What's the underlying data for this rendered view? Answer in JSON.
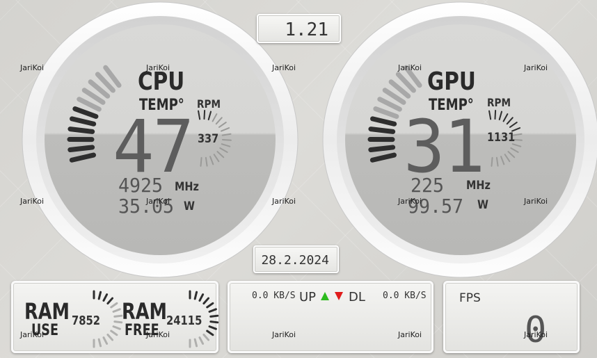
{
  "version": "1.21",
  "date": "28.2.2024",
  "colors": {
    "arrow_up": "#2dbb1e",
    "arrow_down": "#e01c1c",
    "segment_dark": "#5d5d5d",
    "segment_ticks_active": "#2e2e2e",
    "segment_ticks_inactive": "#a8a8a8"
  },
  "cpu": {
    "title": "CPU",
    "subtitle": "TEMP°",
    "temp": "47",
    "rpm_label": "RPM",
    "rpm": "337",
    "clock": "4925",
    "clock_unit": "MHz",
    "power": "35.05",
    "power_unit": "W",
    "temp_level": 0.55,
    "rpm_level": 0.15
  },
  "gpu": {
    "title": "GPU",
    "subtitle": "TEMP°",
    "temp": "31",
    "rpm_label": "RPM",
    "rpm": "1131",
    "clock": "225",
    "clock_unit": "MHz",
    "power": "99.57",
    "power_unit": "W",
    "temp_level": 0.4,
    "rpm_level": 0.45
  },
  "ram": {
    "label": "RAM",
    "use_label": "USE",
    "free_label": "FREE",
    "use_value": "7852",
    "free_value": "24115",
    "use_level": 0.3,
    "free_level": 0.7
  },
  "network": {
    "up_speed": "0.0 KB/S",
    "up_label": "UP",
    "dl_label": "DL",
    "dl_speed": "0.0 KB/S",
    "up_arrow_icon": "arrow-up-icon",
    "down_arrow_icon": "arrow-down-icon"
  },
  "fps": {
    "label": "FPS",
    "value": "0"
  },
  "watermark": "JariKoi"
}
